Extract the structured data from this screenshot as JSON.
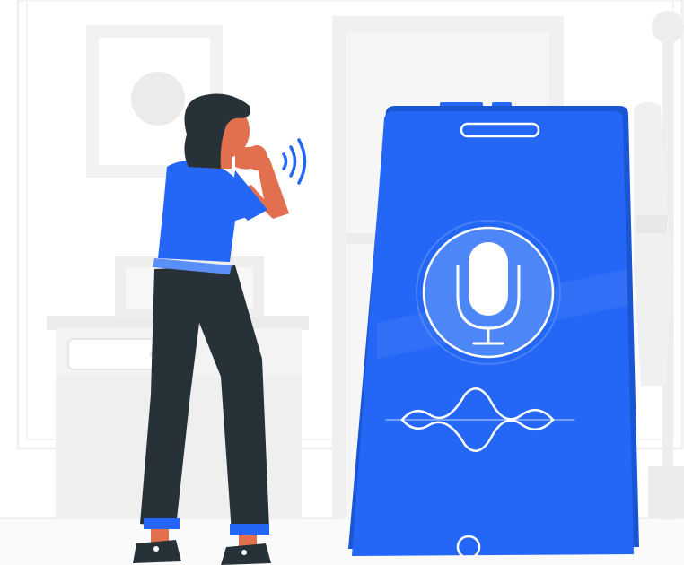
{
  "illustration": {
    "colors": {
      "accent": "#2467f6",
      "accent_dark": "#1a55d4",
      "background_gray": "#f2f2f2",
      "furniture_gray": "#ebebeb",
      "line_gray": "#e3e3e3",
      "skin": "#e2704f",
      "hair": "#263238",
      "pants": "#263238",
      "white": "#ffffff"
    },
    "icons": [
      "microphone-icon",
      "sound-wave-icon",
      "voice-waves-icon"
    ],
    "phone": {
      "state": "listening"
    }
  }
}
